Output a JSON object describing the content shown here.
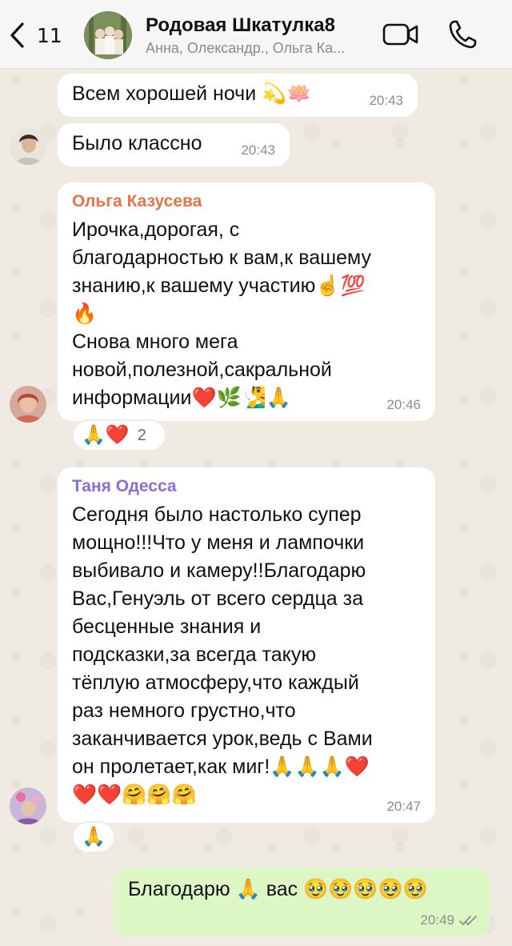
{
  "header": {
    "back_count": "11",
    "title": "Родовая Шкатулка8",
    "subtitle": "Анна, Олександр., Ольга Ка..."
  },
  "messages": [
    {
      "text": "Всем хорошей ночи 💫🪷",
      "time": "20:43"
    },
    {
      "text": "Было классно",
      "time": "20:43"
    },
    {
      "sender": "Ольга Казусева",
      "sender_color": "#e5734a",
      "lines": [
        "Ирочка,дорогая, с",
        "благодарностью к вам,к вашему",
        "знанию,к вашему участию☝️💯",
        "🔥",
        "Снова много мега",
        "новой,полезной,сакральной",
        "информации❤️🌿🧏‍♂️🙏"
      ],
      "time": "20:46",
      "reaction": {
        "emojis": "🙏❤️",
        "count": "2"
      }
    },
    {
      "sender": "Таня Одесса",
      "sender_color": "#8b6fd6",
      "lines": [
        "Сегодня было настолько супер",
        "мощно!!!Что у меня и лампочки",
        "выбивало и камеру!!Благодарю",
        "Вас,Генуэль от всего сердца за",
        "бесценные знания и",
        "подсказки,за всегда такую",
        "тёплую атмосферу,что каждый",
        "раз немного грустно,что",
        "заканчивается урок,ведь с Вами",
        "он пролетает,как миг!🙏🙏🙏❤️",
        "❤️❤️🤗🤗🤗"
      ],
      "time": "20:47",
      "reaction": {
        "emojis": "🙏"
      }
    },
    {
      "text": "Благодарю 🙏 вас 🥹🥹🥹🥹🥹",
      "time": "20:49",
      "outgoing": true
    }
  ],
  "colors": {
    "background": "#efeae2",
    "incoming_bubble": "#ffffff",
    "outgoing_bubble": "#dcf7c5"
  }
}
